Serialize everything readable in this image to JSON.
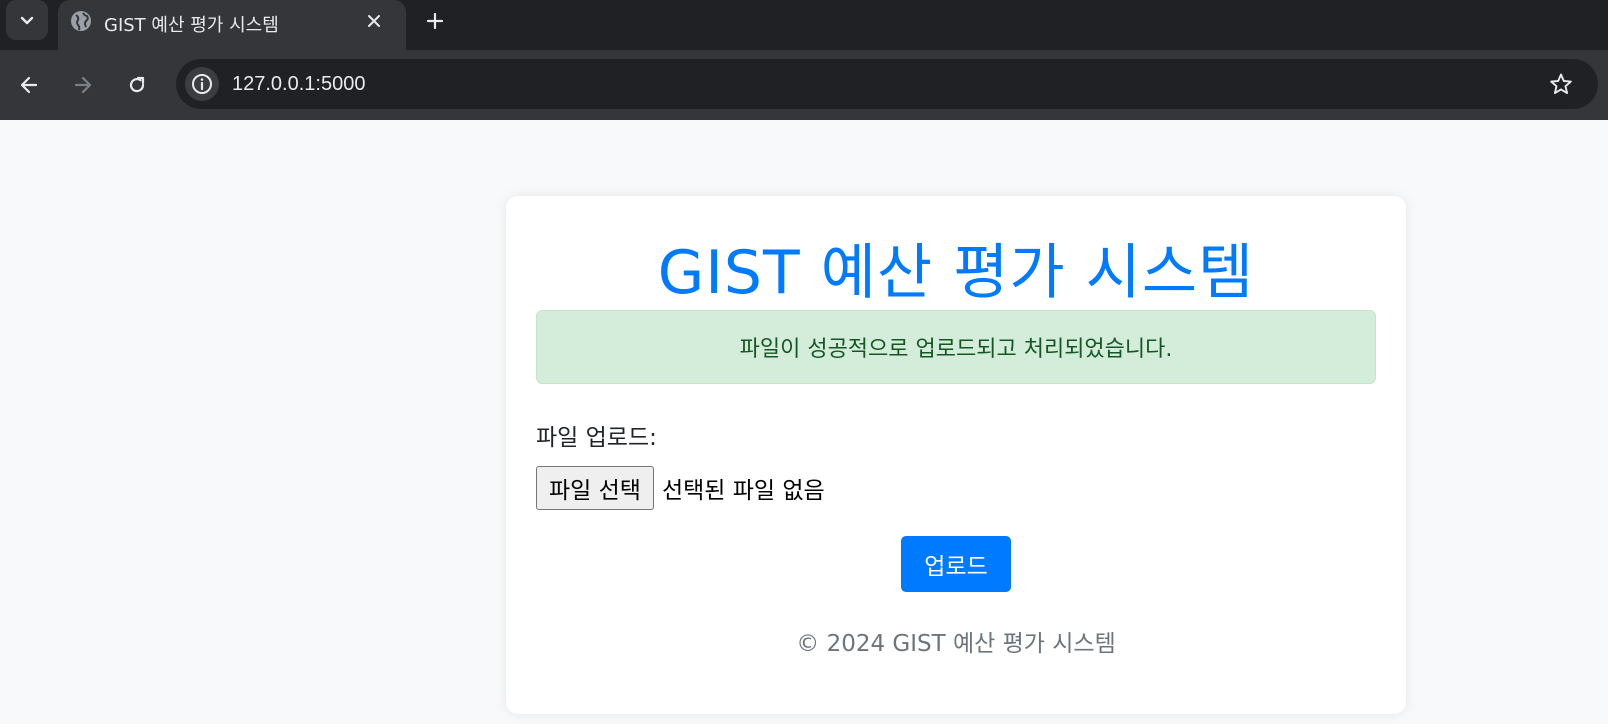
{
  "browser": {
    "tab_title": "GIST 예산 평가 시스템",
    "url": "127.0.0.1:5000",
    "icons": {
      "tab_search": "chevron-down-icon",
      "favicon": "globe-icon",
      "close": "close-icon",
      "new_tab": "plus-icon",
      "back": "arrow-left-icon",
      "forward": "arrow-right-icon",
      "reload": "reload-icon",
      "site_info": "info-icon",
      "bookmark": "star-icon"
    }
  },
  "page": {
    "title": "GIST 예산 평가 시스템",
    "alert_message": "파일이 성공적으로 업로드되고 처리되었습니다.",
    "upload_label": "파일 업로드:",
    "file_button_label": "파일 선택",
    "file_status": "선택된 파일 없음",
    "upload_button_label": "업로드",
    "footer": "© 2024 GIST 예산 평가 시스템"
  },
  "colors": {
    "accent": "#007bff",
    "success_bg": "#d4edda",
    "success_text": "#155724",
    "muted_text": "#6c757d"
  }
}
